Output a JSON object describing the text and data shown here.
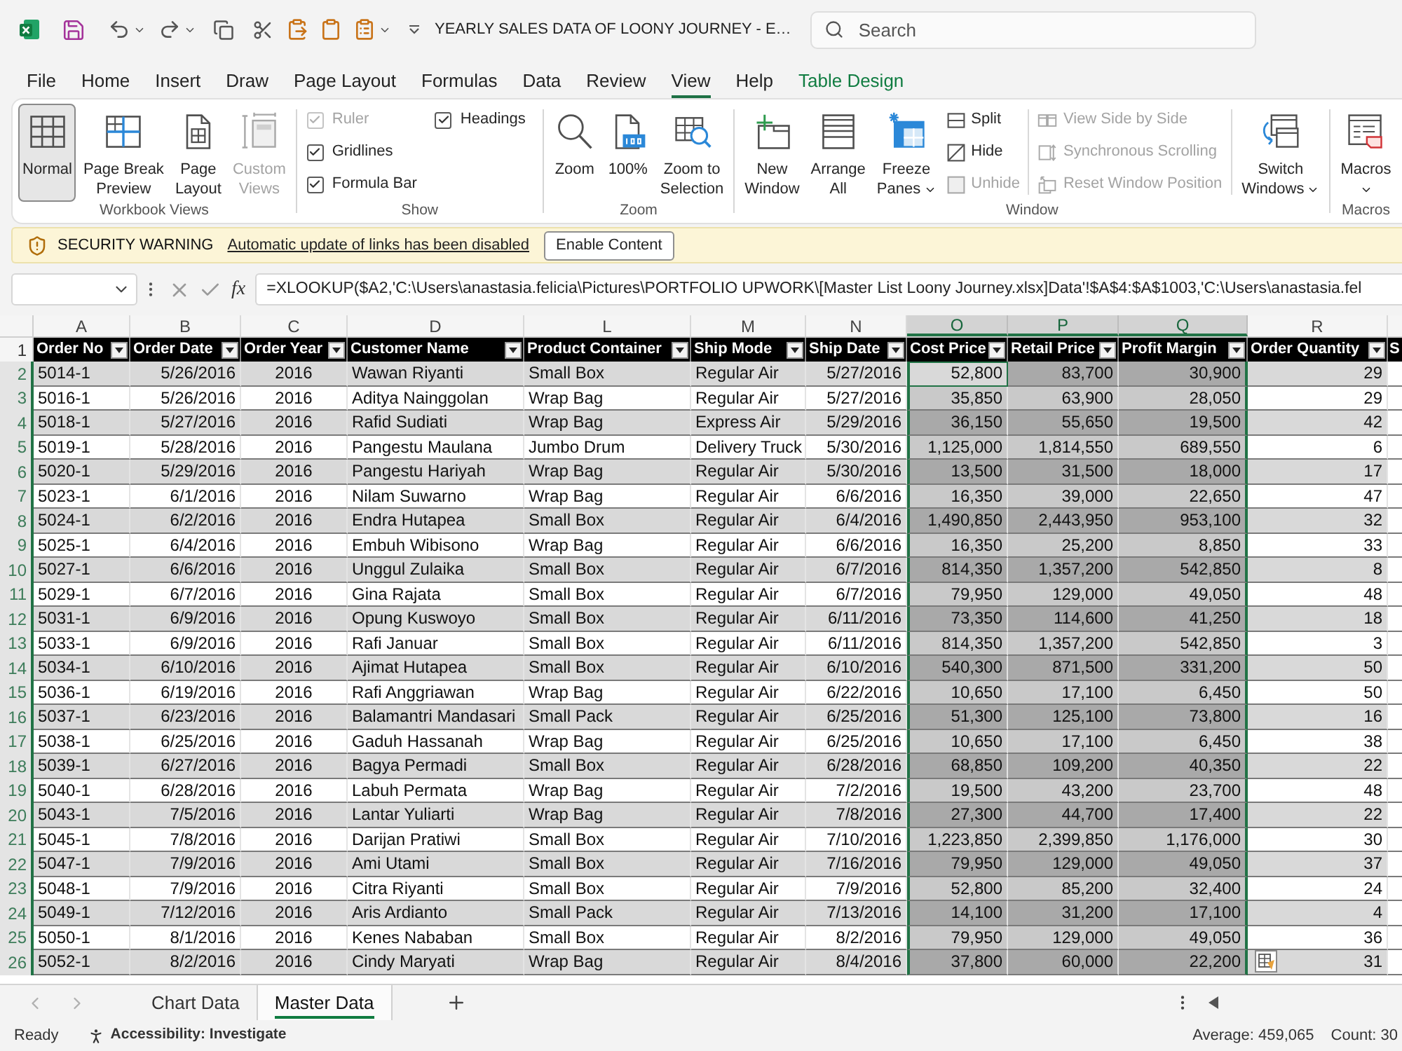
{
  "title_bar": {
    "title": "YEARLY SALES DATA OF LOONY JOURNEY - E…",
    "search": {
      "placeholder": "Search"
    }
  },
  "ribbon_tabs": [
    {
      "label": "File",
      "selected": false,
      "contextual": false
    },
    {
      "label": "Home",
      "selected": false,
      "contextual": false
    },
    {
      "label": "Insert",
      "selected": false,
      "contextual": false
    },
    {
      "label": "Draw",
      "selected": false,
      "contextual": false
    },
    {
      "label": "Page Layout",
      "selected": false,
      "contextual": false
    },
    {
      "label": "Formulas",
      "selected": false,
      "contextual": false
    },
    {
      "label": "Data",
      "selected": false,
      "contextual": false
    },
    {
      "label": "Review",
      "selected": false,
      "contextual": false
    },
    {
      "label": "View",
      "selected": true,
      "contextual": false
    },
    {
      "label": "Help",
      "selected": false,
      "contextual": false
    },
    {
      "label": "Table Design",
      "selected": false,
      "contextual": true
    }
  ],
  "ribbon": {
    "groups": [
      {
        "label": "Workbook Views",
        "items": [
          {
            "kind": "large",
            "label": "Normal",
            "selected": true,
            "disabled": false
          },
          {
            "kind": "large",
            "label": "Page Break Preview",
            "selected": false,
            "disabled": false
          },
          {
            "kind": "large",
            "label": "Page Layout",
            "selected": false,
            "disabled": false
          },
          {
            "kind": "large",
            "label": "Custom Views",
            "selected": false,
            "disabled": true
          }
        ]
      },
      {
        "label": "Show",
        "items": [
          {
            "kind": "checkbox",
            "label": "Ruler",
            "checked": true,
            "disabled": true
          },
          {
            "kind": "checkbox",
            "label": "Gridlines",
            "checked": true,
            "disabled": false
          },
          {
            "kind": "checkbox",
            "label": "Formula Bar",
            "checked": true,
            "disabled": false
          },
          {
            "kind": "checkbox",
            "label": "Headings",
            "checked": true,
            "disabled": false
          }
        ]
      },
      {
        "label": "Zoom",
        "items": [
          {
            "kind": "large",
            "label": "Zoom",
            "disabled": false
          },
          {
            "kind": "large",
            "label": "100%",
            "disabled": false
          },
          {
            "kind": "large",
            "label": "Zoom to Selection",
            "disabled": false
          }
        ]
      },
      {
        "label": "Window",
        "items": [
          {
            "kind": "large",
            "label": "New Window",
            "disabled": false
          },
          {
            "kind": "large",
            "label": "Arrange All",
            "disabled": false
          },
          {
            "kind": "large",
            "label": "Freeze Panes",
            "disabled": false,
            "dropdown": true
          },
          {
            "kind": "small",
            "label": "Split",
            "disabled": false
          },
          {
            "kind": "small",
            "label": "Hide",
            "disabled": false
          },
          {
            "kind": "small",
            "label": "Unhide",
            "disabled": true
          },
          {
            "kind": "small",
            "label": "View Side by Side",
            "disabled": true
          },
          {
            "kind": "small",
            "label": "Synchronous Scrolling",
            "disabled": true
          },
          {
            "kind": "small",
            "label": "Reset Window Position",
            "disabled": true
          },
          {
            "kind": "large",
            "label": "Switch Windows",
            "disabled": false,
            "dropdown": true
          }
        ]
      },
      {
        "label": "Macros",
        "items": [
          {
            "kind": "large",
            "label": "Macros",
            "disabled": false,
            "dropdown": true
          }
        ]
      }
    ]
  },
  "security_bar": {
    "title": "SECURITY WARNING",
    "message": "Automatic update of links has been disabled",
    "button": "Enable Content"
  },
  "formula_bar": {
    "function_label": "fx",
    "formula": "=XLOOKUP($A2,'C:\\Users\\anastasia.felicia\\Pictures\\PORTFOLIO UPWORK\\[Master List Loony Journey.xlsx]Data'!$A$4:$A$1003,'C:\\Users\\anastasia.fel"
  },
  "table": {
    "columns": [
      {
        "letter": "A",
        "heading": "Order No",
        "kind": "text",
        "selected": false,
        "active": false,
        "filter": true
      },
      {
        "letter": "B",
        "heading": "Order Date",
        "kind": "date",
        "selected": false,
        "active": false,
        "filter": true
      },
      {
        "letter": "C",
        "heading": "Order Year",
        "kind": "year",
        "selected": false,
        "active": false,
        "filter": true
      },
      {
        "letter": "D",
        "heading": "Customer Name",
        "kind": "text",
        "selected": false,
        "active": false,
        "filter": true
      },
      {
        "letter": "L",
        "heading": "Product Container",
        "kind": "text",
        "selected": false,
        "active": false,
        "filter": true
      },
      {
        "letter": "M",
        "heading": "Ship Mode",
        "kind": "text",
        "selected": false,
        "active": false,
        "filter": true
      },
      {
        "letter": "N",
        "heading": "Ship Date",
        "kind": "date",
        "selected": false,
        "active": false,
        "filter": true
      },
      {
        "letter": "O",
        "heading": "Cost Price",
        "kind": "number",
        "selected": true,
        "active": true,
        "filter": true
      },
      {
        "letter": "P",
        "heading": "Retail Price",
        "kind": "number",
        "selected": true,
        "active": false,
        "filter": true
      },
      {
        "letter": "Q",
        "heading": "Profit Margin",
        "kind": "number",
        "selected": true,
        "active": false,
        "filter": true
      },
      {
        "letter": "R",
        "heading": "Order Quantity",
        "kind": "number",
        "selected": false,
        "active": false,
        "filter": true
      },
      {
        "heading": "S"
      }
    ],
    "header_row": {
      "number": "1",
      "selected": false
    },
    "rows": [
      {
        "number": "2",
        "selected": true,
        "active": true,
        "cells": [
          "5014-1",
          "5/26/2016",
          "2016",
          "Wawan Riyanti",
          "Small Box",
          "Regular Air",
          "5/27/2016",
          "52,800",
          "83,700",
          "30,900",
          "29"
        ]
      },
      {
        "number": "3",
        "selected": true,
        "active": false,
        "cells": [
          "5016-1",
          "5/26/2016",
          "2016",
          "Aditya Nainggolan",
          "Wrap Bag",
          "Regular Air",
          "5/27/2016",
          "35,850",
          "63,900",
          "28,050",
          "29"
        ]
      },
      {
        "number": "4",
        "selected": true,
        "active": false,
        "cells": [
          "5018-1",
          "5/27/2016",
          "2016",
          "Rafid Sudiati",
          "Wrap Bag",
          "Express Air",
          "5/29/2016",
          "36,150",
          "55,650",
          "19,500",
          "42"
        ]
      },
      {
        "number": "5",
        "selected": true,
        "active": false,
        "cells": [
          "5019-1",
          "5/28/2016",
          "2016",
          "Pangestu Maulana",
          "Jumbo Drum",
          "Delivery Truck",
          "5/30/2016",
          "1,125,000",
          "1,814,550",
          "689,550",
          "6"
        ]
      },
      {
        "number": "6",
        "selected": true,
        "active": false,
        "cells": [
          "5020-1",
          "5/29/2016",
          "2016",
          "Pangestu Hariyah",
          "Wrap Bag",
          "Regular Air",
          "5/30/2016",
          "13,500",
          "31,500",
          "18,000",
          "17"
        ]
      },
      {
        "number": "7",
        "selected": true,
        "active": false,
        "cells": [
          "5023-1",
          "6/1/2016",
          "2016",
          "Nilam Suwarno",
          "Wrap Bag",
          "Regular Air",
          "6/6/2016",
          "16,350",
          "39,000",
          "22,650",
          "47"
        ]
      },
      {
        "number": "8",
        "selected": true,
        "active": false,
        "cells": [
          "5024-1",
          "6/2/2016",
          "2016",
          "Endra Hutapea",
          "Small Box",
          "Regular Air",
          "6/4/2016",
          "1,490,850",
          "2,443,950",
          "953,100",
          "32"
        ]
      },
      {
        "number": "9",
        "selected": true,
        "active": false,
        "cells": [
          "5025-1",
          "6/4/2016",
          "2016",
          "Embuh Wibisono",
          "Wrap Bag",
          "Regular Air",
          "6/6/2016",
          "16,350",
          "25,200",
          "8,850",
          "33"
        ]
      },
      {
        "number": "10",
        "selected": true,
        "active": false,
        "cells": [
          "5027-1",
          "6/6/2016",
          "2016",
          "Unggul Zulaika",
          "Small Box",
          "Regular Air",
          "6/7/2016",
          "814,350",
          "1,357,200",
          "542,850",
          "8"
        ]
      },
      {
        "number": "11",
        "selected": true,
        "active": false,
        "cells": [
          "5029-1",
          "6/7/2016",
          "2016",
          "Gina Rajata",
          "Small Box",
          "Regular Air",
          "6/7/2016",
          "79,950",
          "129,000",
          "49,050",
          "48"
        ]
      },
      {
        "number": "12",
        "selected": true,
        "active": false,
        "cells": [
          "5031-1",
          "6/9/2016",
          "2016",
          "Opung Kuswoyo",
          "Small Box",
          "Regular Air",
          "6/11/2016",
          "73,350",
          "114,600",
          "41,250",
          "18"
        ]
      },
      {
        "number": "13",
        "selected": true,
        "active": false,
        "cells": [
          "5033-1",
          "6/9/2016",
          "2016",
          "Rafi Januar",
          "Small Box",
          "Regular Air",
          "6/11/2016",
          "814,350",
          "1,357,200",
          "542,850",
          "3"
        ]
      },
      {
        "number": "14",
        "selected": true,
        "active": false,
        "cells": [
          "5034-1",
          "6/10/2016",
          "2016",
          "Ajimat Hutapea",
          "Small Box",
          "Regular Air",
          "6/10/2016",
          "540,300",
          "871,500",
          "331,200",
          "50"
        ]
      },
      {
        "number": "15",
        "selected": true,
        "active": false,
        "cells": [
          "5036-1",
          "6/19/2016",
          "2016",
          "Rafi Anggriawan",
          "Wrap Bag",
          "Regular Air",
          "6/22/2016",
          "10,650",
          "17,100",
          "6,450",
          "50"
        ]
      },
      {
        "number": "16",
        "selected": true,
        "active": false,
        "cells": [
          "5037-1",
          "6/23/2016",
          "2016",
          "Balamantri Mandasari",
          "Small Pack",
          "Regular Air",
          "6/25/2016",
          "51,300",
          "125,100",
          "73,800",
          "16"
        ]
      },
      {
        "number": "17",
        "selected": true,
        "active": false,
        "cells": [
          "5038-1",
          "6/25/2016",
          "2016",
          "Gaduh Hassanah",
          "Wrap Bag",
          "Regular Air",
          "6/25/2016",
          "10,650",
          "17,100",
          "6,450",
          "38"
        ]
      },
      {
        "number": "18",
        "selected": true,
        "active": false,
        "cells": [
          "5039-1",
          "6/27/2016",
          "2016",
          "Bagya Permadi",
          "Small Box",
          "Regular Air",
          "6/28/2016",
          "68,850",
          "109,200",
          "40,350",
          "22"
        ]
      },
      {
        "number": "19",
        "selected": true,
        "active": false,
        "cells": [
          "5040-1",
          "6/28/2016",
          "2016",
          "Labuh Permata",
          "Wrap Bag",
          "Regular Air",
          "7/2/2016",
          "19,500",
          "43,200",
          "23,700",
          "48"
        ]
      },
      {
        "number": "20",
        "selected": true,
        "active": false,
        "cells": [
          "5043-1",
          "7/5/2016",
          "2016",
          "Lantar Yuliarti",
          "Wrap Bag",
          "Regular Air",
          "7/8/2016",
          "27,300",
          "44,700",
          "17,400",
          "22"
        ]
      },
      {
        "number": "21",
        "selected": true,
        "active": false,
        "cells": [
          "5045-1",
          "7/8/2016",
          "2016",
          "Darijan Pratiwi",
          "Small Box",
          "Regular Air",
          "7/10/2016",
          "1,223,850",
          "2,399,850",
          "1,176,000",
          "30"
        ]
      },
      {
        "number": "22",
        "selected": true,
        "active": false,
        "cells": [
          "5047-1",
          "7/9/2016",
          "2016",
          "Ami Utami",
          "Small Box",
          "Regular Air",
          "7/16/2016",
          "79,950",
          "129,000",
          "49,050",
          "37"
        ]
      },
      {
        "number": "23",
        "selected": true,
        "active": false,
        "cells": [
          "5048-1",
          "7/9/2016",
          "2016",
          "Citra Riyanti",
          "Small Box",
          "Regular Air",
          "7/9/2016",
          "52,800",
          "85,200",
          "32,400",
          "24"
        ]
      },
      {
        "number": "24",
        "selected": true,
        "active": false,
        "cells": [
          "5049-1",
          "7/12/2016",
          "2016",
          "Aris Ardianto",
          "Small Pack",
          "Regular Air",
          "7/13/2016",
          "14,100",
          "31,200",
          "17,100",
          "4"
        ]
      },
      {
        "number": "25",
        "selected": true,
        "active": false,
        "cells": [
          "5050-1",
          "8/1/2016",
          "2016",
          "Kenes Nababan",
          "Small Box",
          "Regular Air",
          "8/2/2016",
          "79,950",
          "129,000",
          "49,050",
          "36"
        ]
      },
      {
        "number": "26",
        "selected": true,
        "active": false,
        "cells": [
          "5052-1",
          "8/2/2016",
          "2016",
          "Cindy Maryati",
          "Wrap Bag",
          "Regular Air",
          "8/4/2016",
          "37,800",
          "60,000",
          "22,200",
          "31"
        ]
      }
    ]
  },
  "sheet_tabs": [
    {
      "label": "Chart Data",
      "selected": false
    },
    {
      "label": "Master Data",
      "selected": true
    }
  ],
  "status_bar": {
    "mode": "Ready",
    "accessibility": "Accessibility: Investigate",
    "average": "Average: 459,065",
    "count": "Count: 30"
  }
}
